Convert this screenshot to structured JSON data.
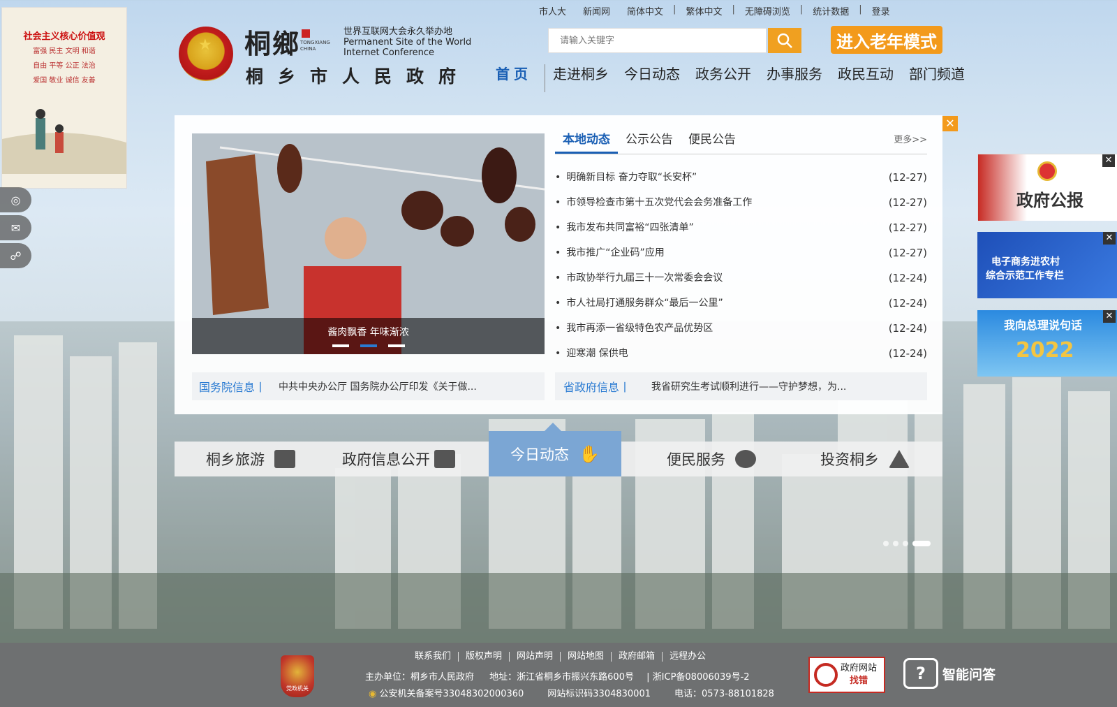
{
  "topbar": {
    "links": [
      "市人大",
      "新闻网",
      "简体中文",
      "繁体中文",
      "无障碍浏览",
      "统计数据",
      "登录"
    ]
  },
  "logo": {
    "calligraphy": "桐鄉",
    "tx_en": "TONGXIANG CHINA",
    "wic_cn": "世界互联网大会永久举办地",
    "wic_en1": "Permanent Site of the World",
    "wic_en2": "Internet Conference",
    "name": "桐乡市人民政府"
  },
  "search": {
    "placeholder": "请输入关键字"
  },
  "elder_mode": "进入老年模式",
  "nav": {
    "home": "首页",
    "items": [
      "走进桐乡",
      "今日动态",
      "政务公开",
      "办事服务",
      "政民互动",
      "部门频道"
    ]
  },
  "left_ad": {
    "title": "社会主义核心价值观",
    "lines": [
      "富强 民主 文明 和谐",
      "自由 平等 公正 法治",
      "爱国 敬业 诚信 友善"
    ]
  },
  "photo": {
    "caption": "酱肉飘香 年味渐浓"
  },
  "tabs": {
    "items": [
      "本地动态",
      "公示公告",
      "便民公告"
    ],
    "more": "更多>>"
  },
  "news": [
    {
      "title": "明确新目标 奋力夺取“长安杯”",
      "date": "(12-27)"
    },
    {
      "title": "市领导检查市第十五次党代会会务准备工作",
      "date": "(12-27)"
    },
    {
      "title": "我市发布共同富裕“四张清单”",
      "date": "(12-27)"
    },
    {
      "title": "我市推广“企业码”应用",
      "date": "(12-27)"
    },
    {
      "title": "市政协举行九届三十一次常委会会议",
      "date": "(12-24)"
    },
    {
      "title": "市人社局打通服务群众“最后一公里”",
      "date": "(12-24)"
    },
    {
      "title": "我市再添一省级特色农产品优势区",
      "date": "(12-24)"
    },
    {
      "title": "迎寒潮 保供电",
      "date": "(12-24)"
    }
  ],
  "info_strip": {
    "guowuyuan_label": "国务院信息丨",
    "guowuyuan_text": "中共中央办公厅 国务院办公厅印发《关于做...",
    "sheng_label": "省政府信息丨",
    "sheng_text": "我省研究生考试顺利进行——守护梦想，为..."
  },
  "cards": [
    "桐乡旅游",
    "政府信息公开",
    "今日动态",
    "便民服务",
    "投资桐乡"
  ],
  "right_ads": {
    "gazette": "政府公报",
    "ecommerce1": "电子商务进农村",
    "ecommerce2": "综合示范工作专栏",
    "premier": "我向总理说句话",
    "premier_year": "2022"
  },
  "footer": {
    "links": [
      "联系我们",
      "版权声明",
      "网站声明",
      "网站地图",
      "政府邮箱",
      "远程办公"
    ],
    "host": "主办单位：桐乡市人民政府",
    "address": "地址：浙江省桐乡市振兴东路600号",
    "icp": "浙ICP备08006039号-2",
    "police": "公安机关备案号33048302000360",
    "site_id": "网站标识码3304830001",
    "phone": "电话：0573-88101828",
    "party_badge": "党政机关",
    "findbug_1": "政府网站",
    "findbug_2": "找错",
    "smart_qa": "智能问答"
  },
  "colors": {
    "accent_blue": "#1a5fb4",
    "orange": "#f39a1b",
    "footer_gray": "#6e7071"
  }
}
